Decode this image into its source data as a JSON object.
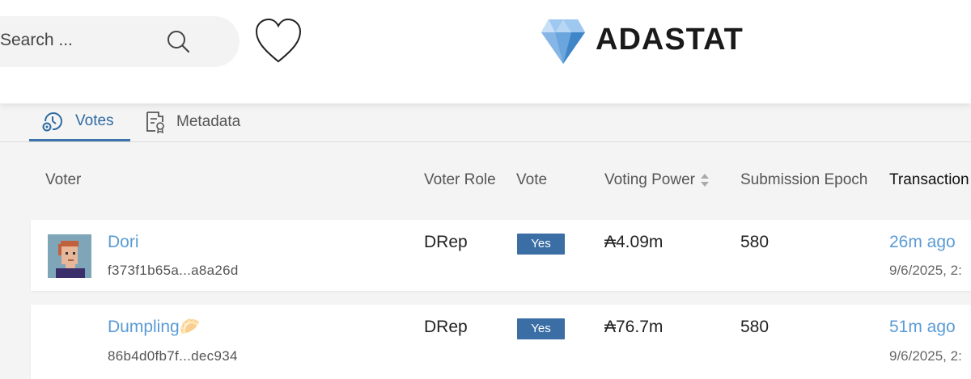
{
  "header": {
    "search_placeholder": "Search ...",
    "brand": "ADASTAT"
  },
  "tabs": [
    {
      "label": "Votes",
      "icon": "clock-gear-icon",
      "active": true
    },
    {
      "label": "Metadata",
      "icon": "document-badge-icon",
      "active": false
    }
  ],
  "table": {
    "columns": [
      "Voter",
      "Voter Role",
      "Vote",
      "Voting Power",
      "Submission Epoch",
      "Transaction"
    ],
    "rows": [
      {
        "name": "Dori",
        "hash": "f373f1b65a...a8a26d",
        "role": "DRep",
        "vote": "Yes",
        "power": "₳4.09m",
        "epoch": "580",
        "time": "26m ago",
        "date": "9/6/2025, 2:"
      },
      {
        "name": "Dumpling🥟",
        "hash": "86b4d0fb7f...dec934",
        "role": "DRep",
        "vote": "Yes",
        "power": "₳76.7m",
        "epoch": "580",
        "time": "51m ago",
        "date": "9/6/2025, 2:"
      }
    ]
  },
  "colors": {
    "accent": "#3a73aa",
    "link": "#5b9bd5",
    "badge": "#3a6ea5"
  }
}
